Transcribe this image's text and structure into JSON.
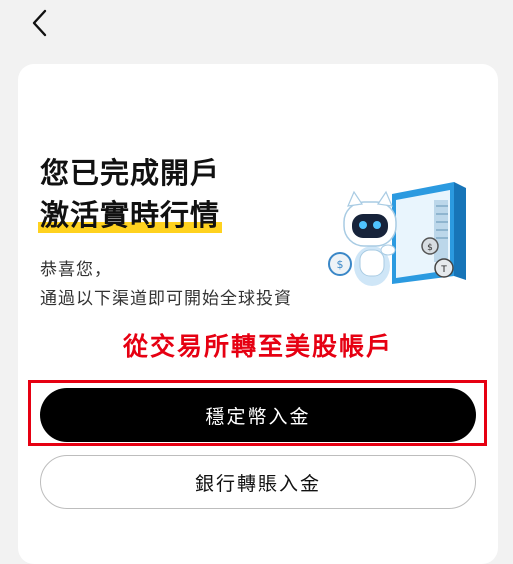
{
  "nav": {
    "back_icon": "chevron-left-icon"
  },
  "card": {
    "title_line1": "您已完成開戶",
    "title_line2": "激活實時行情",
    "subtitle_line1": "恭喜您，",
    "subtitle_line2": "通過以下渠道即可開始全球投資",
    "illustration": "robot-mascot-with-vault-illustration",
    "highlight_color": "#ffd21f"
  },
  "annotation": {
    "text": "從交易所轉至美股帳戶",
    "color": "#e60012"
  },
  "buttons": {
    "primary_label": "穩定幣入金",
    "secondary_label": "銀行轉賬入金"
  }
}
